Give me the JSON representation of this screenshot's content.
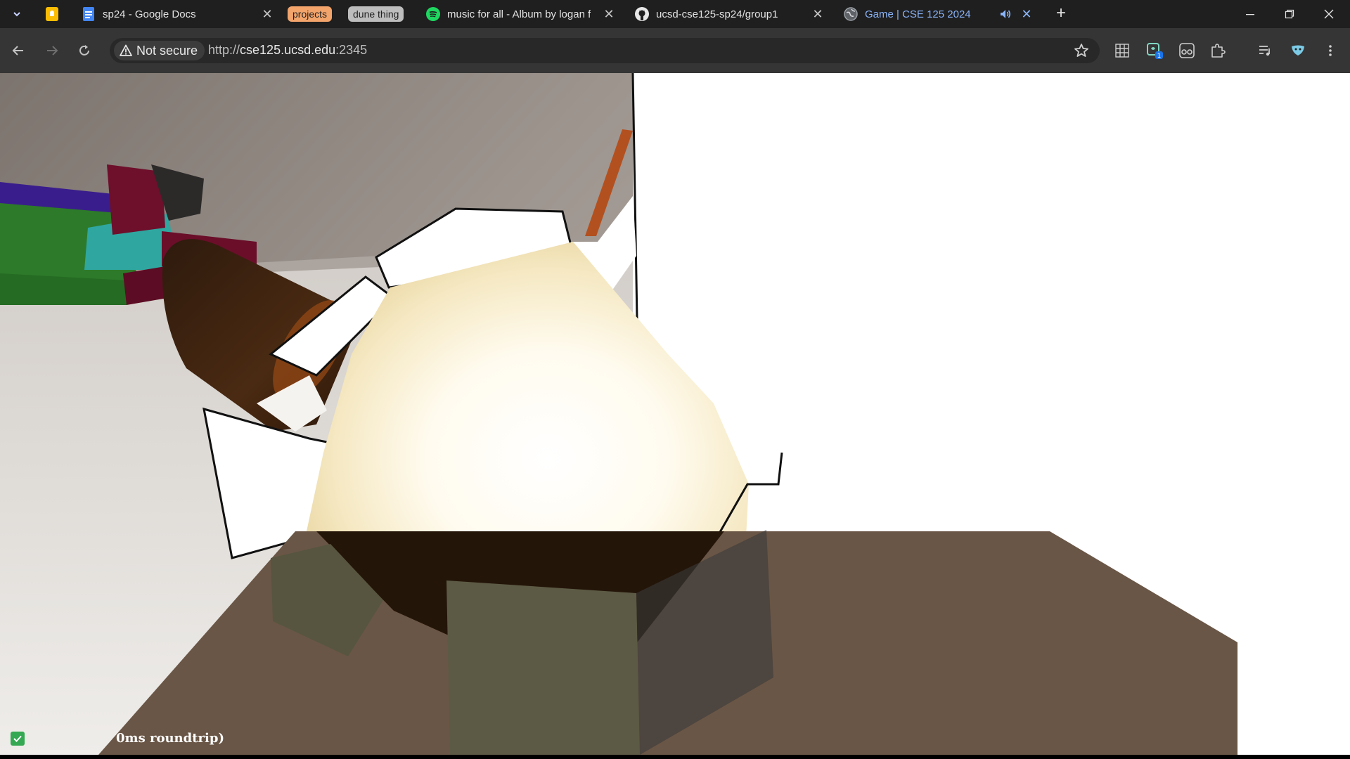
{
  "tabstrip": {
    "tabs": [
      {
        "title": "sp24 - Google Docs",
        "icon": "google-docs-icon"
      },
      {
        "title": "music for all - Album by logan f",
        "icon": "spotify-icon"
      },
      {
        "title": "ucsd-cse125-sp24/group1",
        "icon": "github-icon"
      },
      {
        "title": "Game | CSE 125 2024",
        "icon": "globe-icon",
        "active": true,
        "audio": true
      }
    ],
    "groups": [
      {
        "label": "projects",
        "color": "#f2a46b"
      },
      {
        "label": "dune thing",
        "color": "#bdbdbd"
      }
    ],
    "new_tab": "+"
  },
  "toolbar": {
    "security_label": "Not secure",
    "url_scheme": "http://",
    "url_host": "cse125.ucsd.edu",
    "url_port": ":2345"
  },
  "game": {
    "status_text": "0ms roundtrip)",
    "status_checkbox_checked": true
  },
  "colors": {
    "tabstrip_bg": "#1f1f1f",
    "toolbar_bg": "#353535",
    "active_tab_text": "#8ab4f8"
  }
}
